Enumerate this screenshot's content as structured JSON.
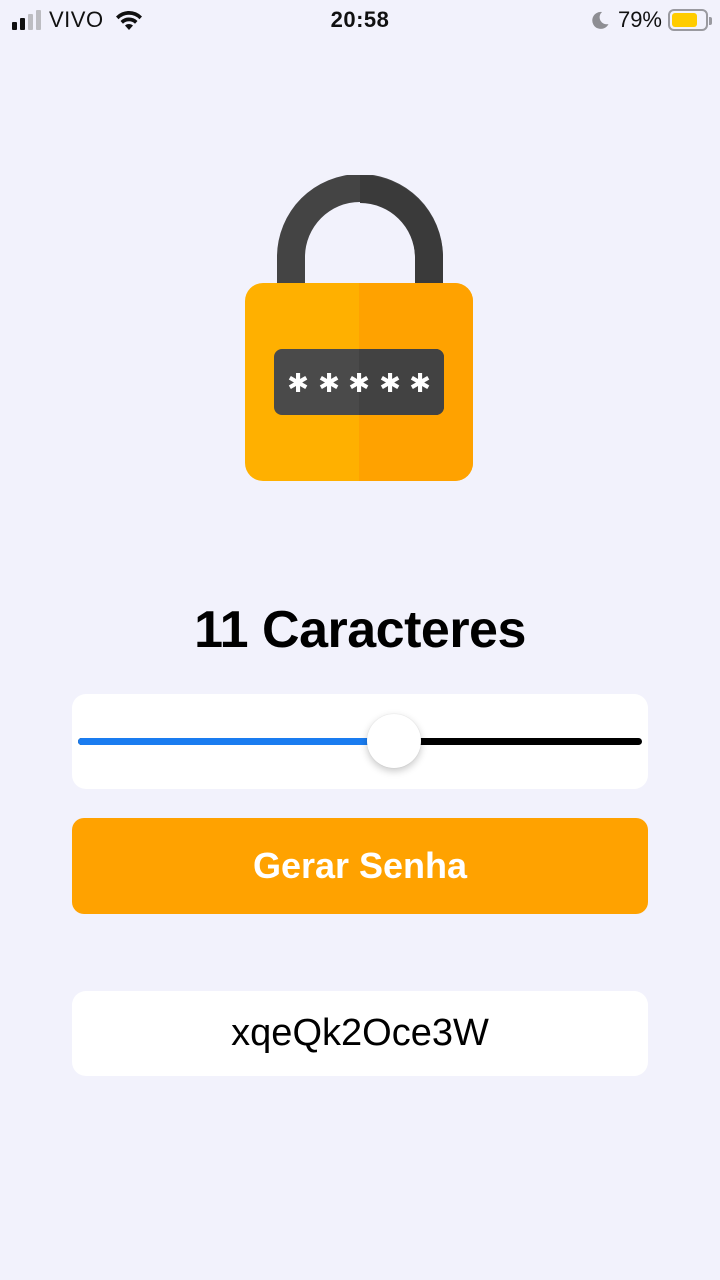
{
  "status_bar": {
    "carrier": "VIVO",
    "time": "20:58",
    "battery_percent": "79%",
    "battery_level": 0.79,
    "signal_bars_active": 2,
    "signal_bars_total": 4,
    "icons": [
      "signal-icon",
      "wifi-icon",
      "moon-icon",
      "battery-icon"
    ]
  },
  "illustration": {
    "icon": "padlock-icon",
    "colors": {
      "shackle": "#444444",
      "body_light": "#ffb000",
      "body_dark": "#ffa200",
      "display": "#474747",
      "asterisk": "#ffffff"
    }
  },
  "length_title": "11 Caracteres",
  "slider": {
    "value": 0.56,
    "colors": {
      "fill": "#1a7cf0",
      "track": "#000000"
    }
  },
  "generate_button": {
    "label": "Gerar Senha",
    "color": "#ffa200"
  },
  "password": {
    "value": "xqeQk2Oce3W"
  },
  "background_color": "#f2f2fc"
}
